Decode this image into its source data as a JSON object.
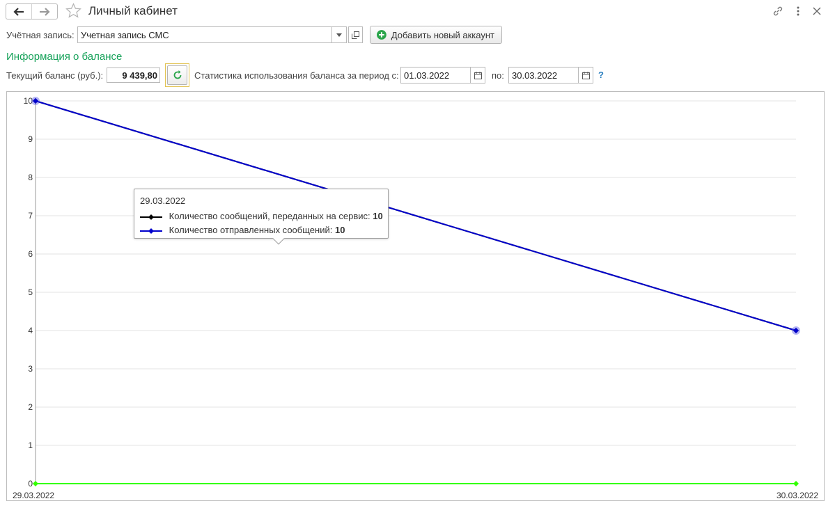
{
  "window": {
    "title": "Личный кабинет",
    "back_icon": "arrow-left-icon",
    "forward_icon": "arrow-right-icon",
    "favorite_icon": "star-icon",
    "link_icon": "link-icon",
    "more_icon": "more-vertical-icon",
    "close_icon": "close-icon"
  },
  "account": {
    "label": "Учётная запись:",
    "value": "Учетная запись СМС",
    "add_button_label": "Добавить новый аккаунт"
  },
  "balance": {
    "section_title": "Информация о балансе",
    "current_label": "Текущий баланс (руб.):",
    "current_value": "9 439,80",
    "period_label": "Статистика использования баланса за период с:",
    "date_from": "01.03.2022",
    "to_label": "по:",
    "date_to": "30.03.2022",
    "help": "?"
  },
  "colors": {
    "accent_green": "#17a25a",
    "series_black": "#000000",
    "series_blue": "#0000cc",
    "series_green": "#33ff00"
  },
  "tooltip": {
    "date": "29.03.2022",
    "items": [
      {
        "label": "Количество сообщений, переданных на сервис:",
        "value": "10"
      },
      {
        "label": "Количество отправленных сообщений:",
        "value": "10"
      }
    ]
  },
  "chart_data": {
    "type": "line",
    "x": [
      "29.03.2022",
      "30.03.2022"
    ],
    "ylim": [
      0,
      10
    ],
    "yticks": [
      "0",
      "1",
      "2",
      "3",
      "4",
      "5",
      "6",
      "7",
      "8",
      "9",
      "10"
    ],
    "grid": true,
    "series": [
      {
        "name": "Количество сообщений, переданных на сервис",
        "color": "#000000",
        "values": [
          10,
          4
        ]
      },
      {
        "name": "Количество отправленных сообщений",
        "color": "#0000cc",
        "values": [
          10,
          4
        ]
      },
      {
        "color": "#33ff00",
        "values": [
          0,
          0
        ]
      }
    ]
  }
}
